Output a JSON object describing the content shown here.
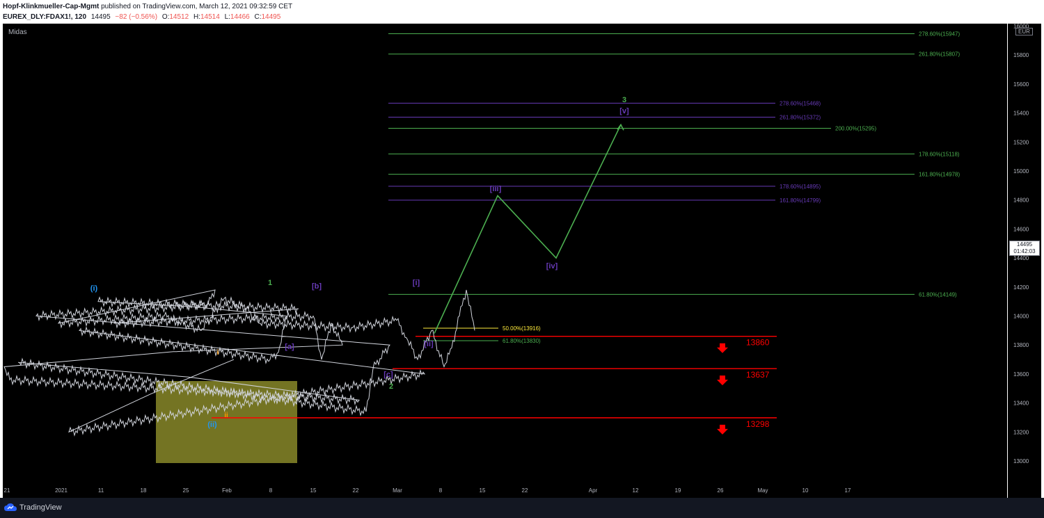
{
  "header": {
    "author": "Hopf-Klinkmueller-Cap-Mgmt",
    "published": "published on TradingView.com, March 12, 2021 09:32:59 CET",
    "symbol": "EUREX_DLY:FDAX1!, 120",
    "last": "14495",
    "change": "−82 (−0.56%)",
    "o_label": "O:",
    "o_value": "14512",
    "h_label": "H:",
    "h_value": "14514",
    "l_label": "L:",
    "l_value": "14466",
    "c_label": "C:",
    "c_value": "14495"
  },
  "indicator_label": "Midas",
  "currency": "EUR",
  "current_price_tag": {
    "price": "14495",
    "countdown": "01:42:03"
  },
  "footer": {
    "brand": "TradingView"
  },
  "colors": {
    "background": "#000000",
    "green": "#4caf50",
    "purple": "#673ab7",
    "red": "#ff0000",
    "yellow": "#ffeb3b",
    "candle": "#d1d4dc",
    "box": "#7a7a25"
  },
  "chart_data": {
    "type": "line",
    "y_axis": {
      "min": 12900,
      "max": 16000,
      "ticks": [
        13000,
        13200,
        13400,
        13600,
        13800,
        14000,
        14200,
        14400,
        14600,
        14800,
        15000,
        15200,
        15400,
        15600,
        15800,
        16000
      ],
      "side": "right"
    },
    "x_axis": {
      "tick_labels": [
        "21",
        "2021",
        "11",
        "18",
        "25",
        "Feb",
        "8",
        "15",
        "22",
        "Mar",
        "8",
        "15",
        "22",
        "Apr",
        "12",
        "19",
        "26",
        "May",
        "10",
        "17"
      ]
    },
    "price_path": [
      [
        "21",
        13700
      ],
      [
        "22",
        13200
      ],
      [
        "24",
        13600
      ],
      [
        "28",
        13900
      ],
      [
        "2021",
        13700
      ],
      [
        "4",
        13750
      ],
      [
        "6",
        14000
      ],
      [
        "11",
        14100
      ],
      [
        "12",
        14050
      ],
      [
        "14",
        13950
      ],
      [
        "16",
        14000
      ],
      [
        "18",
        13700
      ],
      [
        "20",
        13950
      ],
      [
        "22",
        13800
      ],
      [
        "25",
        13650
      ],
      [
        "27",
        13560
      ],
      [
        "28",
        13420
      ],
      [
        "29",
        13680
      ],
      [
        "30",
        13340
      ],
      [
        "Feb",
        13640
      ],
      [
        "2",
        13800
      ],
      [
        "4",
        14000
      ],
      [
        "6",
        14080
      ],
      [
        "8",
        14180
      ],
      [
        "9",
        13950
      ],
      [
        "10",
        14000
      ],
      [
        "12",
        13900
      ],
      [
        "15",
        14120
      ],
      [
        "16",
        14050
      ],
      [
        "18",
        13950
      ],
      [
        "20",
        13920
      ],
      [
        "22",
        13970
      ],
      [
        "23",
        13850
      ],
      [
        "25",
        13700
      ],
      [
        "26",
        13900
      ],
      [
        "27",
        13650
      ],
      [
        "Mar",
        13780
      ],
      [
        "2",
        14000
      ],
      [
        "4",
        14180
      ],
      [
        "5",
        13900
      ],
      [
        "6",
        13850
      ],
      [
        "8",
        14300
      ],
      [
        "9",
        14450
      ],
      [
        "10",
        14520
      ],
      [
        "11",
        14580
      ],
      [
        "12",
        14495
      ]
    ],
    "wave_projection": {
      "green_path": [
        [
          13880,
          "ii"
        ],
        [
          14830,
          "iii"
        ],
        [
          14400,
          "iv"
        ],
        [
          15320,
          "v"
        ]
      ]
    },
    "horizontal_levels": [
      {
        "value": 15947,
        "label": "278.60%(15947)",
        "color": "#4caf50"
      },
      {
        "value": 15807,
        "label": "261.80%(15807)",
        "color": "#4caf50"
      },
      {
        "value": 15468,
        "label": "278.60%(15468)",
        "color": "#673ab7"
      },
      {
        "value": 15372,
        "label": "261.80%(15372)",
        "color": "#673ab7"
      },
      {
        "value": 15295,
        "label": "200.00%(15295)",
        "color": "#4caf50"
      },
      {
        "value": 15118,
        "label": "178.60%(15118)",
        "color": "#4caf50"
      },
      {
        "value": 14978,
        "label": "161.80%(14978)",
        "color": "#4caf50"
      },
      {
        "value": 14895,
        "label": "178.60%(14895)",
        "color": "#673ab7"
      },
      {
        "value": 14799,
        "label": "161.80%(14799)",
        "color": "#673ab7"
      },
      {
        "value": 14149,
        "label": "61.80%(14149)",
        "color": "#4caf50"
      },
      {
        "value": 13916,
        "label": "50.00%(13916)",
        "color": "#ffeb3b"
      },
      {
        "value": 13830,
        "label": "61.80%(13830)",
        "color": "#4caf50"
      }
    ],
    "stop_levels": [
      {
        "value": 13860,
        "label": "13860"
      },
      {
        "value": 13637,
        "label": "13637"
      },
      {
        "value": 13298,
        "label": "13298"
      }
    ],
    "wave_labels": [
      {
        "text": "(i)",
        "color": "#2196f3"
      },
      {
        "text": "(ii)",
        "color": "#2196f3"
      },
      {
        "text": "i",
        "color": "#ff9800"
      },
      {
        "text": "ii",
        "color": "#ff9800"
      },
      {
        "text": "1",
        "color": "#4caf50"
      },
      {
        "text": "[a]",
        "color": "#673ab7"
      },
      {
        "text": "[b]",
        "color": "#673ab7"
      },
      {
        "text": "[c]",
        "color": "#673ab7"
      },
      {
        "text": "2",
        "color": "#4caf50"
      },
      {
        "text": "[i]",
        "color": "#673ab7"
      },
      {
        "text": "[ii]",
        "color": "#673ab7"
      },
      {
        "text": "[iii]",
        "color": "#673ab7"
      },
      {
        "text": "[iv]",
        "color": "#673ab7"
      },
      {
        "text": "3",
        "color": "#4caf50"
      },
      {
        "text": "[v]",
        "color": "#673ab7"
      }
    ]
  }
}
